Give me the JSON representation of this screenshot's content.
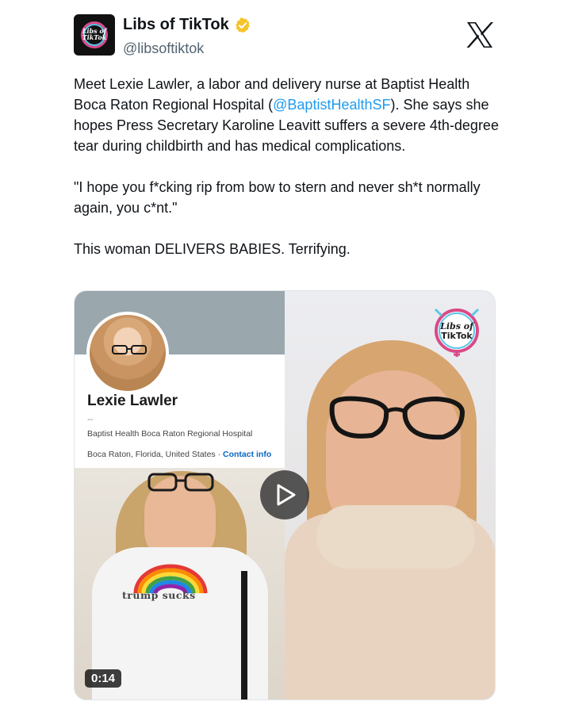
{
  "author": {
    "display_name": "Libs of TikTok",
    "handle": "@libsoftiktok",
    "avatar_text_line1": "Libs of",
    "avatar_text_line2": "TikTok",
    "verified_color": "#f5c42b"
  },
  "platform": {
    "logo": "x-logo-icon"
  },
  "tweet": {
    "para1_before": "Meet Lexie Lawler, a labor and delivery nurse at Baptist Health Boca Raton Regional Hospital (",
    "para1_mention": "@BaptistHealthSF",
    "para1_after": "). She says she hopes Press Secretary Karoline Leavitt suffers a severe 4th-degree tear during childbirth and has medical complications.",
    "para2": "\"I hope you f*cking rip from bow to stern and never sh*t normally again, you c*nt.\"",
    "para3": "This woman DELIVERS BABIES. Terrifying."
  },
  "media": {
    "profile_card": {
      "name": "Lexie Lawler",
      "dash": "--",
      "employer": "Baptist Health Boca Raton Regional Hospital",
      "location": "Boca Raton, Florida, United States · ",
      "contact": "Contact info"
    },
    "shirt_text": "trump sucks",
    "watermark_line1": "Libs of",
    "watermark_line2": "TikTok",
    "duration": "0:14",
    "colors": {
      "mention": "#1d9bf0",
      "contact": "#0a66c2"
    }
  }
}
